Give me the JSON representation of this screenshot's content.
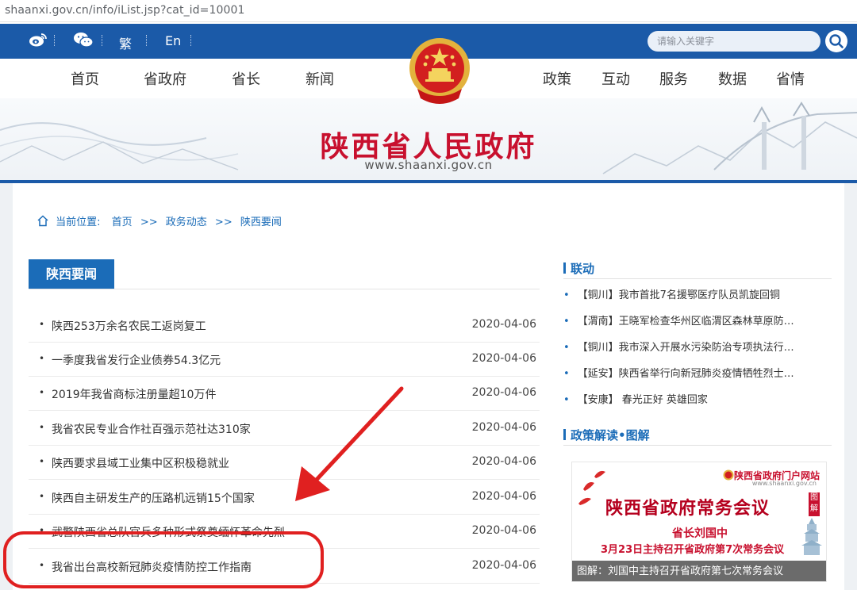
{
  "browser": {
    "url": "shaanxi.gov.cn/info/iList.jsp?cat_id=10001"
  },
  "topbar": {
    "traditional_label": "繁",
    "english_label": "En",
    "search_placeholder": "请输入关键字",
    "weibo_icon": "weibo-icon",
    "wechat_icon": "wechat-icon",
    "search_icon": "search-icon"
  },
  "nav": {
    "left": [
      "首页",
      "省政府",
      "省长",
      "新闻"
    ],
    "right": [
      "政策",
      "互动",
      "服务",
      "数据",
      "省情"
    ]
  },
  "header": {
    "site_title": "陕西省人民政府",
    "site_url": "www.shaanxi.gov.cn",
    "emblem_icon": "national-emblem-icon"
  },
  "breadcrumb": {
    "label": "当前位置:",
    "items": [
      "首页",
      "政务动态",
      "陕西要闻"
    ],
    "separator": ">>"
  },
  "section": {
    "title": "陕西要闻"
  },
  "news": [
    {
      "title": "陕西253万余名农民工返岗复工",
      "date": "2020-04-06"
    },
    {
      "title": "一季度我省发行企业债券54.3亿元",
      "date": "2020-04-06"
    },
    {
      "title": "2019年我省商标注册量超10万件",
      "date": "2020-04-06"
    },
    {
      "title": "我省农民专业合作社百强示范社达310家",
      "date": "2020-04-06"
    },
    {
      "title": "陕西要求县域工业集中区积极稳就业",
      "date": "2020-04-06"
    },
    {
      "title": "陕西自主研发生产的压路机远销15个国家",
      "date": "2020-04-06"
    },
    {
      "title": "武警陕西省总队官兵多种形式祭奠缅怀革命先烈",
      "date": "2020-04-06"
    },
    {
      "title": "我省出台高校新冠肺炎疫情防控工作指南",
      "date": "2020-04-06"
    }
  ],
  "sidebar": {
    "liandong_title": "联动",
    "liandong_items": [
      "【铜川】我市首批7名援鄂医疗队员凯旋回铜",
      "【渭南】王晓军检查华州区临渭区森林草原防…",
      "【铜川】我市深入开展水污染防治专项执法行…",
      "【延安】陕西省举行向新冠肺炎疫情牺牲烈士…",
      "【安康】 春光正好 英雄回家"
    ],
    "policy_title": "政策解读•图解",
    "promo": {
      "site_name": "陕西省政府门户网站",
      "site_url": "www.shaanxi.gov.cn",
      "headline": "陕西省政府常务会议",
      "tag": "图解",
      "sub1": "省长刘国中",
      "sub2": "3月23日主持召开省政府第7次常务会议",
      "caption": "图解：刘国中主持召开省政府第七次常务会议"
    }
  },
  "colors": {
    "primary_blue": "#1b5aa8",
    "link_blue": "#1b6cb8",
    "title_red": "#c8102e",
    "annotation_red": "#e02020"
  }
}
